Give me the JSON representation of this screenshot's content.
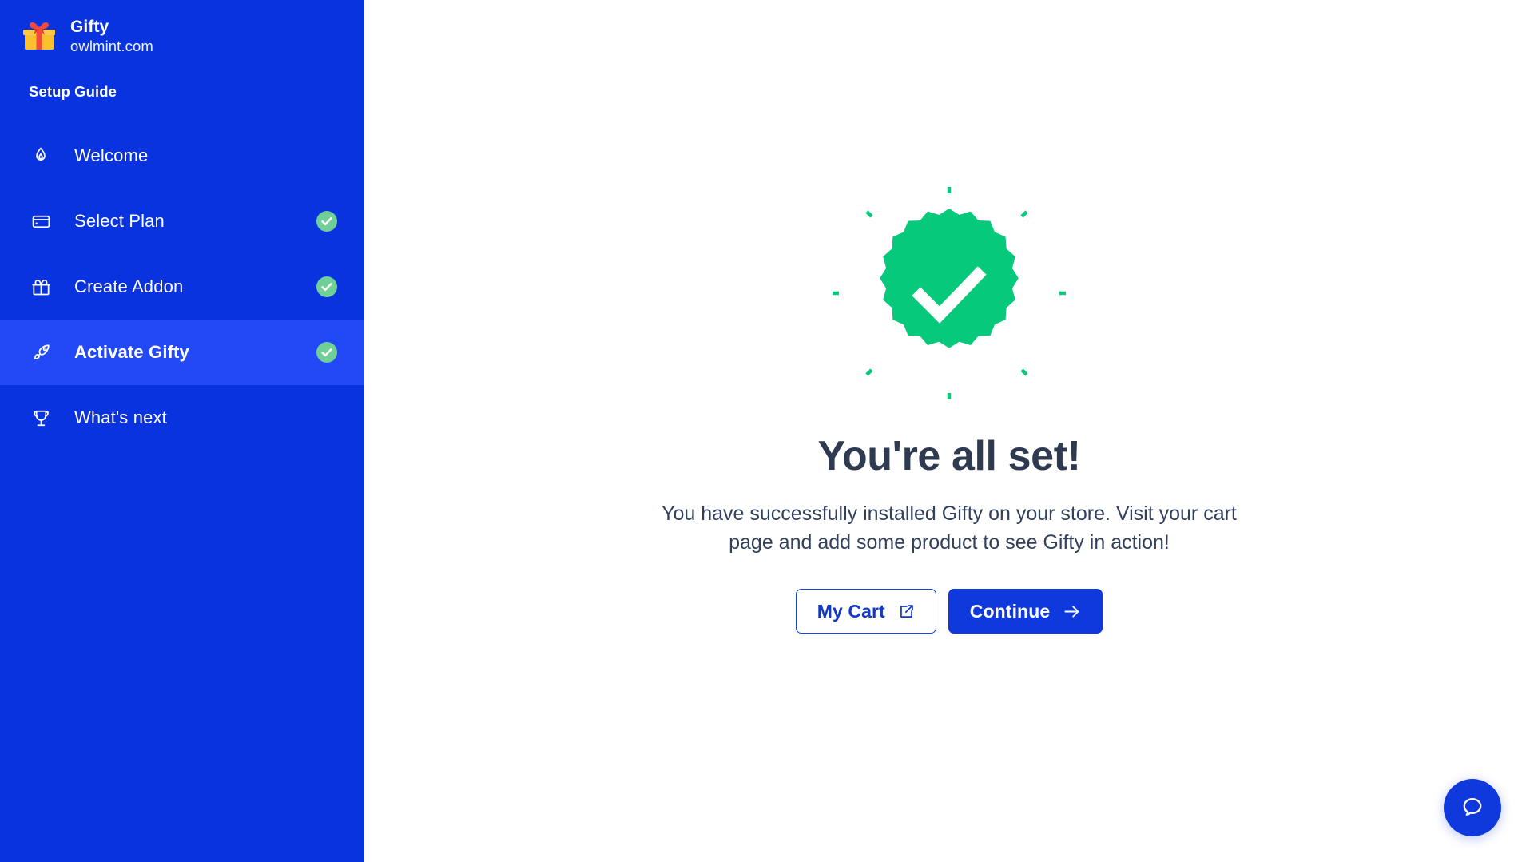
{
  "brand": {
    "logo_icon": "gift-box-logo",
    "name": "Gifty",
    "domain": "owlmint.com"
  },
  "sidebar": {
    "section_title": "Setup Guide",
    "background_color": "#0A33E0",
    "active_color": "#2348F5",
    "check_color": "#6FCF97",
    "items": [
      {
        "label": "Welcome",
        "icon": "flame-icon",
        "completed": false,
        "active": false
      },
      {
        "label": "Select Plan",
        "icon": "credit-card-icon",
        "completed": true,
        "active": false
      },
      {
        "label": "Create Addon",
        "icon": "gift-icon",
        "completed": true,
        "active": false
      },
      {
        "label": "Activate Gifty",
        "icon": "rocket-icon",
        "completed": true,
        "active": true
      },
      {
        "label": "What's next",
        "icon": "trophy-icon",
        "completed": false,
        "active": false
      }
    ]
  },
  "main": {
    "success_badge": {
      "icon": "check-badge-icon",
      "color": "#07C97C",
      "burst_color": "#07C97C"
    },
    "headline": "You're all set!",
    "subtext": "You have successfully installed Gifty on your store. Visit your cart page and add some product to see Gifty in action!",
    "buttons": [
      {
        "label": "My Cart",
        "icon": "external-link-icon",
        "style": "outline",
        "color": "#1139C9"
      },
      {
        "label": "Continue",
        "icon": "arrow-right-icon",
        "style": "primary",
        "color": "#0F38DD"
      }
    ]
  },
  "help_widget": {
    "icon": "chat-bubble-icon",
    "color": "#0F38DD"
  }
}
